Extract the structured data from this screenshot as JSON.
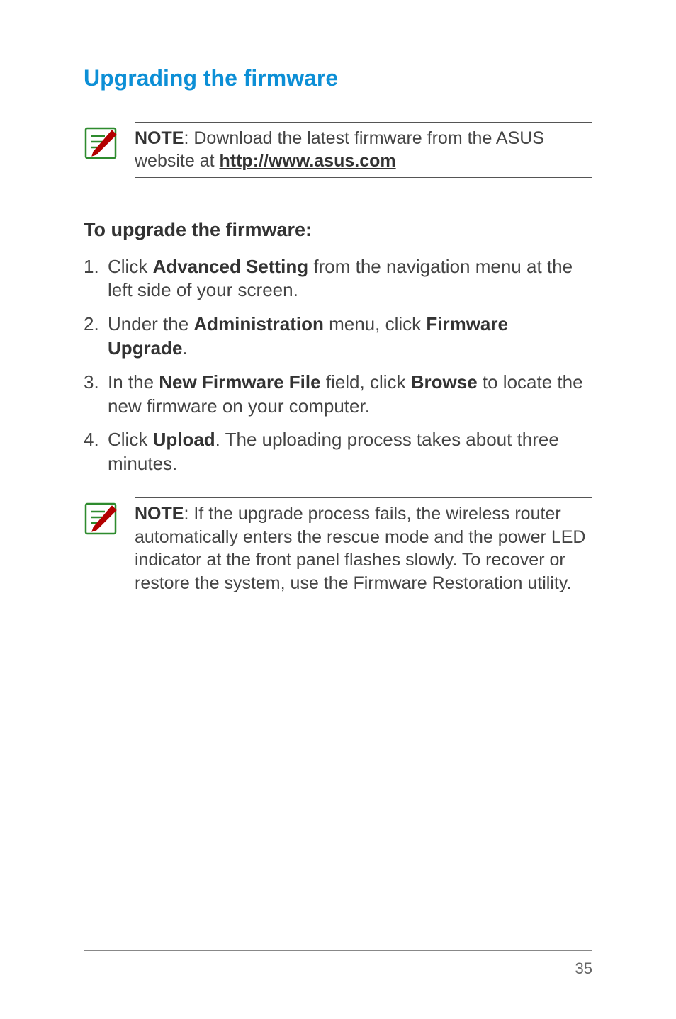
{
  "heading": "Upgrading the firmware",
  "note1": {
    "label": "NOTE",
    "sep": ":",
    "text": "   Download the latest firmware from the ASUS website at ",
    "link": "http://www.asus.com"
  },
  "subheading": "To upgrade the firmware:",
  "steps": [
    {
      "pre": "Click ",
      "b1": "Advanced Setting",
      "post": " from the navigation menu at the left side of your screen."
    },
    {
      "pre": "Under the ",
      "b1": "Administration",
      "mid": " menu, click ",
      "b2": "Firmware Upgrade",
      "post": "."
    },
    {
      "pre": "In the ",
      "b1": "New Firmware File",
      "mid": " field, click ",
      "b2": "Browse",
      "post": " to locate the new firmware on your computer."
    },
    {
      "pre": "Click ",
      "b1": "Upload",
      "post": ". The uploading process takes about three minutes."
    }
  ],
  "note2": {
    "label": "NOTE",
    "sep": ":",
    "text": "   If the upgrade process fails, the wireless router automatically enters the rescue mode and the power LED indicator at the front panel flashes slowly. To recover or restore the system, use the Firmware Restoration utility."
  },
  "pagenum": "35"
}
